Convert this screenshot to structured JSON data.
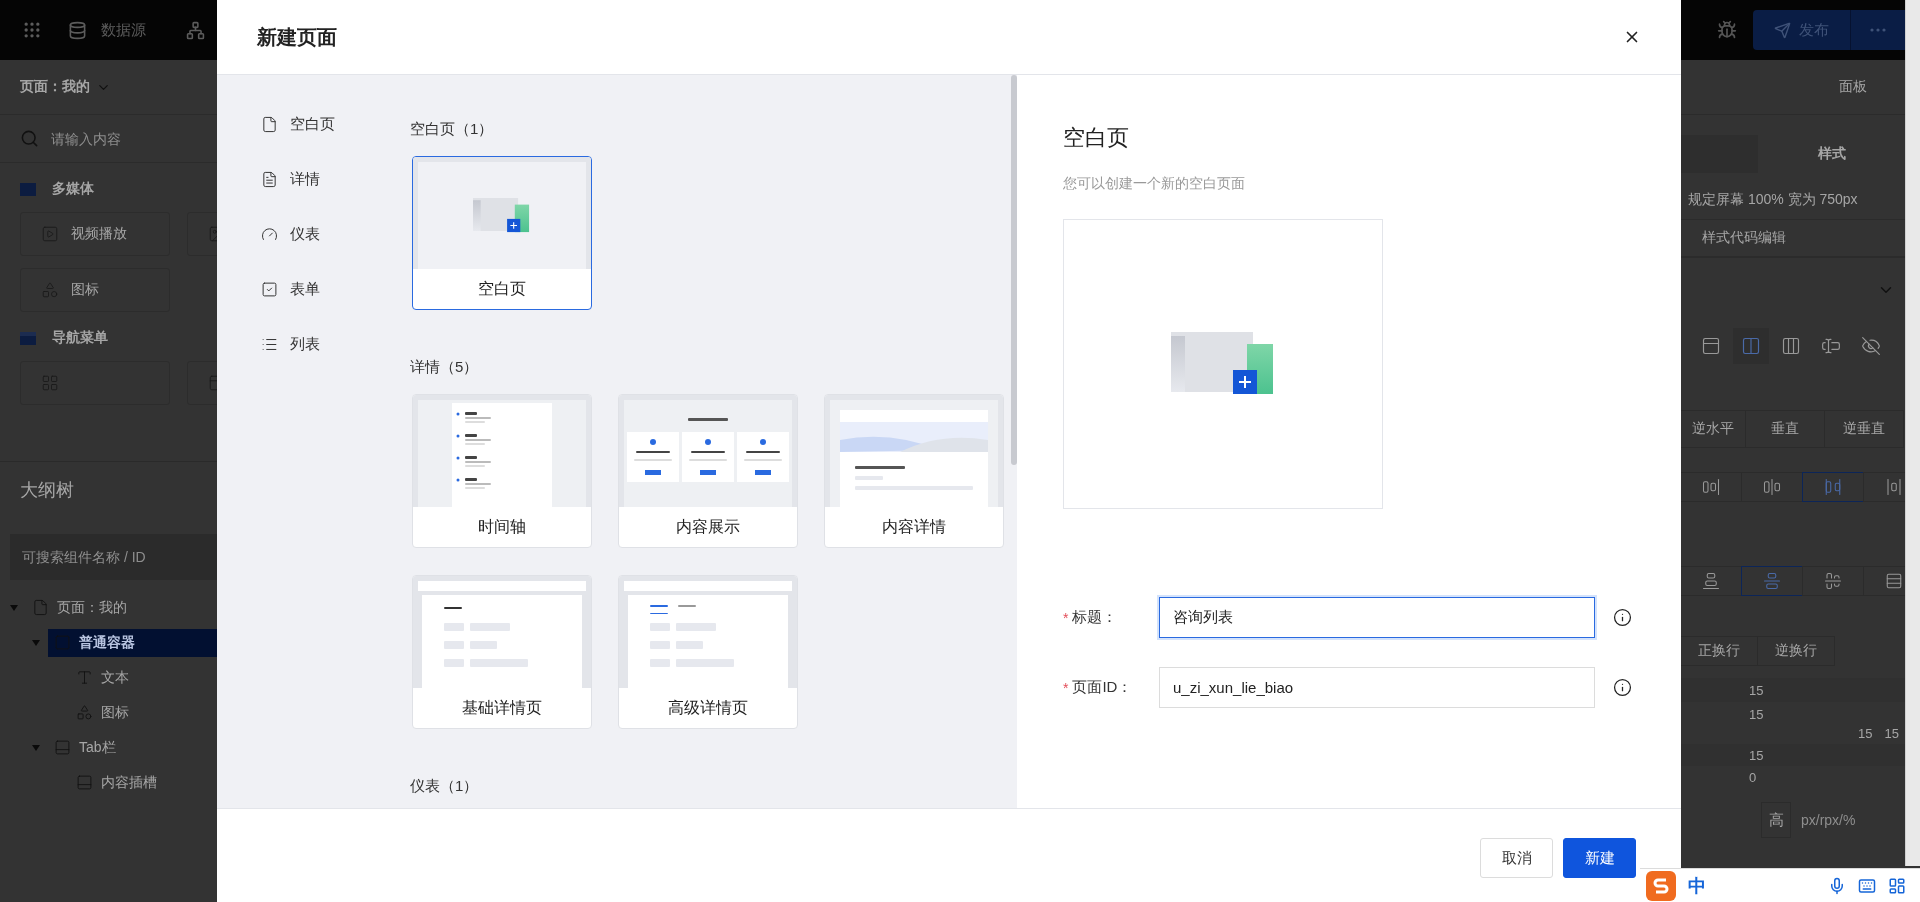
{
  "background_left": {
    "datasource": "数据源",
    "page_select": "页面：我的",
    "search": {
      "placeholder": "请输入内容"
    },
    "groups": [
      {
        "title": "多媒体",
        "kind": "media",
        "items": [
          {
            "kind": "video",
            "label": "视频播放"
          },
          {
            "kind": "image"
          },
          {
            "kind": "icon",
            "label": "图标"
          }
        ]
      },
      {
        "title": "导航菜单",
        "kind": "nav",
        "items": [
          {
            "kind": "grid"
          },
          {
            "kind": "list"
          }
        ]
      }
    ],
    "outline": {
      "title": "大纲树",
      "search": {
        "placeholder": "可搜索组件名称 / ID"
      },
      "tree": [
        {
          "label": "页面：我的",
          "kind": "page",
          "expanded": true,
          "selected": false,
          "children": [
            {
              "label": "普通容器",
              "kind": "container",
              "expanded": true,
              "selected": true,
              "children": [
                {
                  "label": "文本",
                  "kind": "text",
                  "selected": false
                },
                {
                  "label": "图标",
                  "kind": "icon",
                  "selected": false
                }
              ]
            },
            {
              "label": "Tab栏",
              "kind": "tab",
              "expanded": true,
              "selected": false,
              "children": [
                {
                  "label": "内容插槽",
                  "kind": "tab",
                  "selected": false
                }
              ]
            }
          ]
        }
      ]
    }
  },
  "dialog": {
    "title": "新建页面",
    "nav": [
      {
        "label": "空白页",
        "kind": "blank"
      },
      {
        "label": "详情",
        "kind": "detail"
      },
      {
        "label": "仪表",
        "kind": "dashboard"
      },
      {
        "label": "表单",
        "kind": "form"
      },
      {
        "label": "列表",
        "kind": "list"
      }
    ],
    "sections": [
      {
        "title": "空白页（1）",
        "templates": [
          {
            "label": "空白页",
            "kind": "blank",
            "selected": true
          }
        ]
      },
      {
        "title": "详情（5）",
        "templates": [
          {
            "label": "时间轴",
            "kind": "timeline",
            "selected": false
          },
          {
            "label": "内容展示",
            "kind": "showcase",
            "selected": false
          },
          {
            "label": "内容详情",
            "kind": "article",
            "selected": false
          },
          {
            "label": "基础详情页",
            "kind": "basic",
            "selected": false
          },
          {
            "label": "高级详情页",
            "kind": "advanced",
            "selected": false
          }
        ]
      },
      {
        "title": "仪表（1）"
      }
    ],
    "preview": {
      "title": "空白页",
      "description": "您可以创建一个新的空白页面"
    },
    "fields": [
      {
        "label": "标题：",
        "required_mark": "*",
        "value": "咨询列表",
        "focused": true
      },
      {
        "label": "页面ID：",
        "required_mark": "*",
        "value": "u_zi_xun_lie_biao",
        "focused": false
      }
    ],
    "buttons": [
      {
        "label": "取消",
        "kind": "default"
      },
      {
        "label": "新建",
        "kind": "primary"
      }
    ]
  },
  "background_right": {
    "publish": "发布",
    "panel_label": "面板",
    "tabs": [
      {
        "label": "样式",
        "selected": true
      }
    ],
    "screen_note": "规定屏幕 100% 宽为 750px",
    "code_edit": "样式代码编辑",
    "display_modes": [
      {
        "kind": "block",
        "selected": false
      },
      {
        "kind": "flex",
        "selected": true
      },
      {
        "kind": "inline-block",
        "selected": false
      },
      {
        "kind": "inline",
        "selected": false
      },
      {
        "kind": "none",
        "selected": false
      }
    ],
    "directions": [
      {
        "label": "逆水平",
        "selected": false
      },
      {
        "label": "垂直",
        "selected": false
      },
      {
        "label": "逆垂直",
        "selected": false
      }
    ],
    "justify": [
      {
        "kind": "end",
        "selected": false
      },
      {
        "kind": "center",
        "selected": false
      },
      {
        "kind": "between",
        "selected": true
      },
      {
        "kind": "around",
        "selected": false
      }
    ],
    "align": [
      {
        "kind": "end",
        "selected": false
      },
      {
        "kind": "center",
        "selected": true
      },
      {
        "kind": "stretch",
        "selected": false
      },
      {
        "kind": "baseline",
        "selected": false
      }
    ],
    "wraps": [
      {
        "label": "正换行",
        "selected": false
      },
      {
        "label": "逆换行",
        "selected": false
      }
    ],
    "spacing": [
      "15",
      "15",
      "15",
      "0"
    ],
    "spacing_side": [
      "15",
      "15"
    ],
    "size": {
      "label": "高",
      "placeholder": "px/rpx/%"
    }
  },
  "ime_bar": {
    "mode": "中"
  }
}
